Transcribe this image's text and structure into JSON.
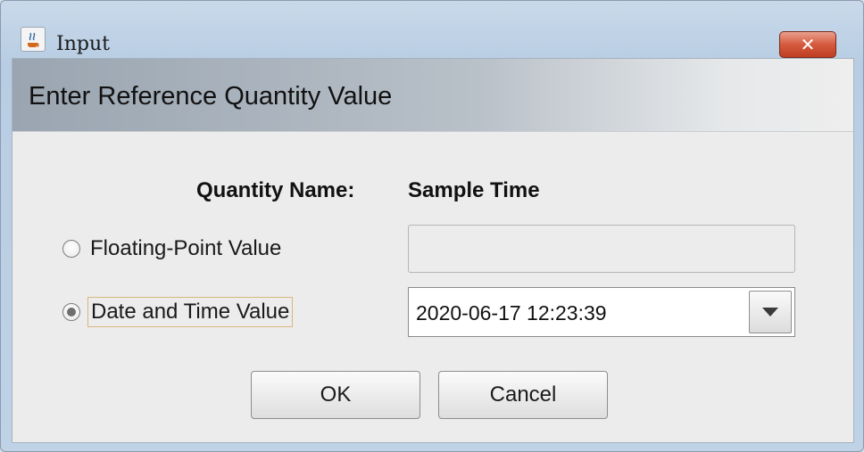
{
  "window": {
    "title": "Input",
    "close_glyph": "✕"
  },
  "dialog": {
    "header_title": "Enter Reference Quantity Value",
    "quantity_name_label": "Quantity Name:",
    "quantity_name_value": "Sample Time"
  },
  "options": {
    "floating_point": {
      "label": "Floating-Point Value",
      "selected": false,
      "value": ""
    },
    "date_time": {
      "label": "Date and Time Value",
      "selected": true,
      "value": "2020-06-17 12:23:39"
    }
  },
  "buttons": {
    "ok_label": "OK",
    "cancel_label": "Cancel"
  },
  "icons": {
    "app": "java-coffee-icon",
    "close": "close-icon",
    "dropdown": "chevron-down-icon"
  }
}
